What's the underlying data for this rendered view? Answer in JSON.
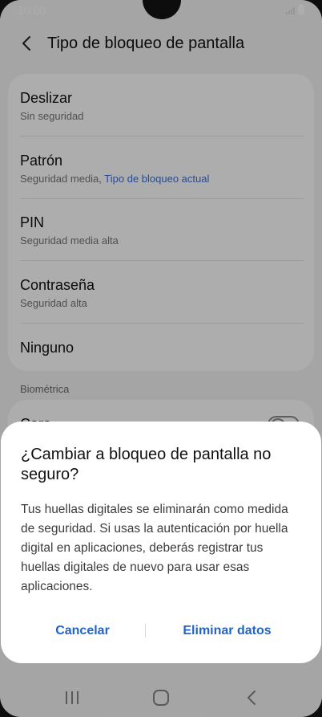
{
  "status_bar": {
    "time": "10:00"
  },
  "header": {
    "title": "Tipo de bloqueo de pantalla"
  },
  "options": [
    {
      "label": "Deslizar",
      "sub": "Sin seguridad",
      "sub_accent": ""
    },
    {
      "label": "Patrón",
      "sub": "Seguridad media,",
      "sub_accent": "Tipo de bloqueo actual"
    },
    {
      "label": "PIN",
      "sub": "Seguridad media alta",
      "sub_accent": ""
    },
    {
      "label": "Contraseña",
      "sub": "Seguridad alta",
      "sub_accent": ""
    },
    {
      "label": "Ninguno",
      "sub": "",
      "sub_accent": ""
    }
  ],
  "biometrics": {
    "section_title": "Biométrica",
    "first_item_label": "Cara",
    "first_item_enabled": false
  },
  "dialog": {
    "title": "¿Cambiar a bloqueo de pantalla no seguro?",
    "body": "Tus huellas digitales se eliminarán como medida de seguridad. Si usas la autenticación por huella digital en aplicaciones, deberás registrar tus huellas digitales de nuevo para usar esas aplicaciones.",
    "cancel_label": "Cancelar",
    "confirm_label": "Eliminar datos"
  },
  "icons": {
    "back": "chevron-left-icon",
    "signal": "signal-icon",
    "battery": "battery-icon",
    "nav_recents": "recents-icon",
    "nav_home": "home-icon",
    "nav_back": "back-nav-icon"
  },
  "colors": {
    "accent": "#2364c8",
    "link": "#3a6fd6",
    "background": "#f4f4f4"
  }
}
